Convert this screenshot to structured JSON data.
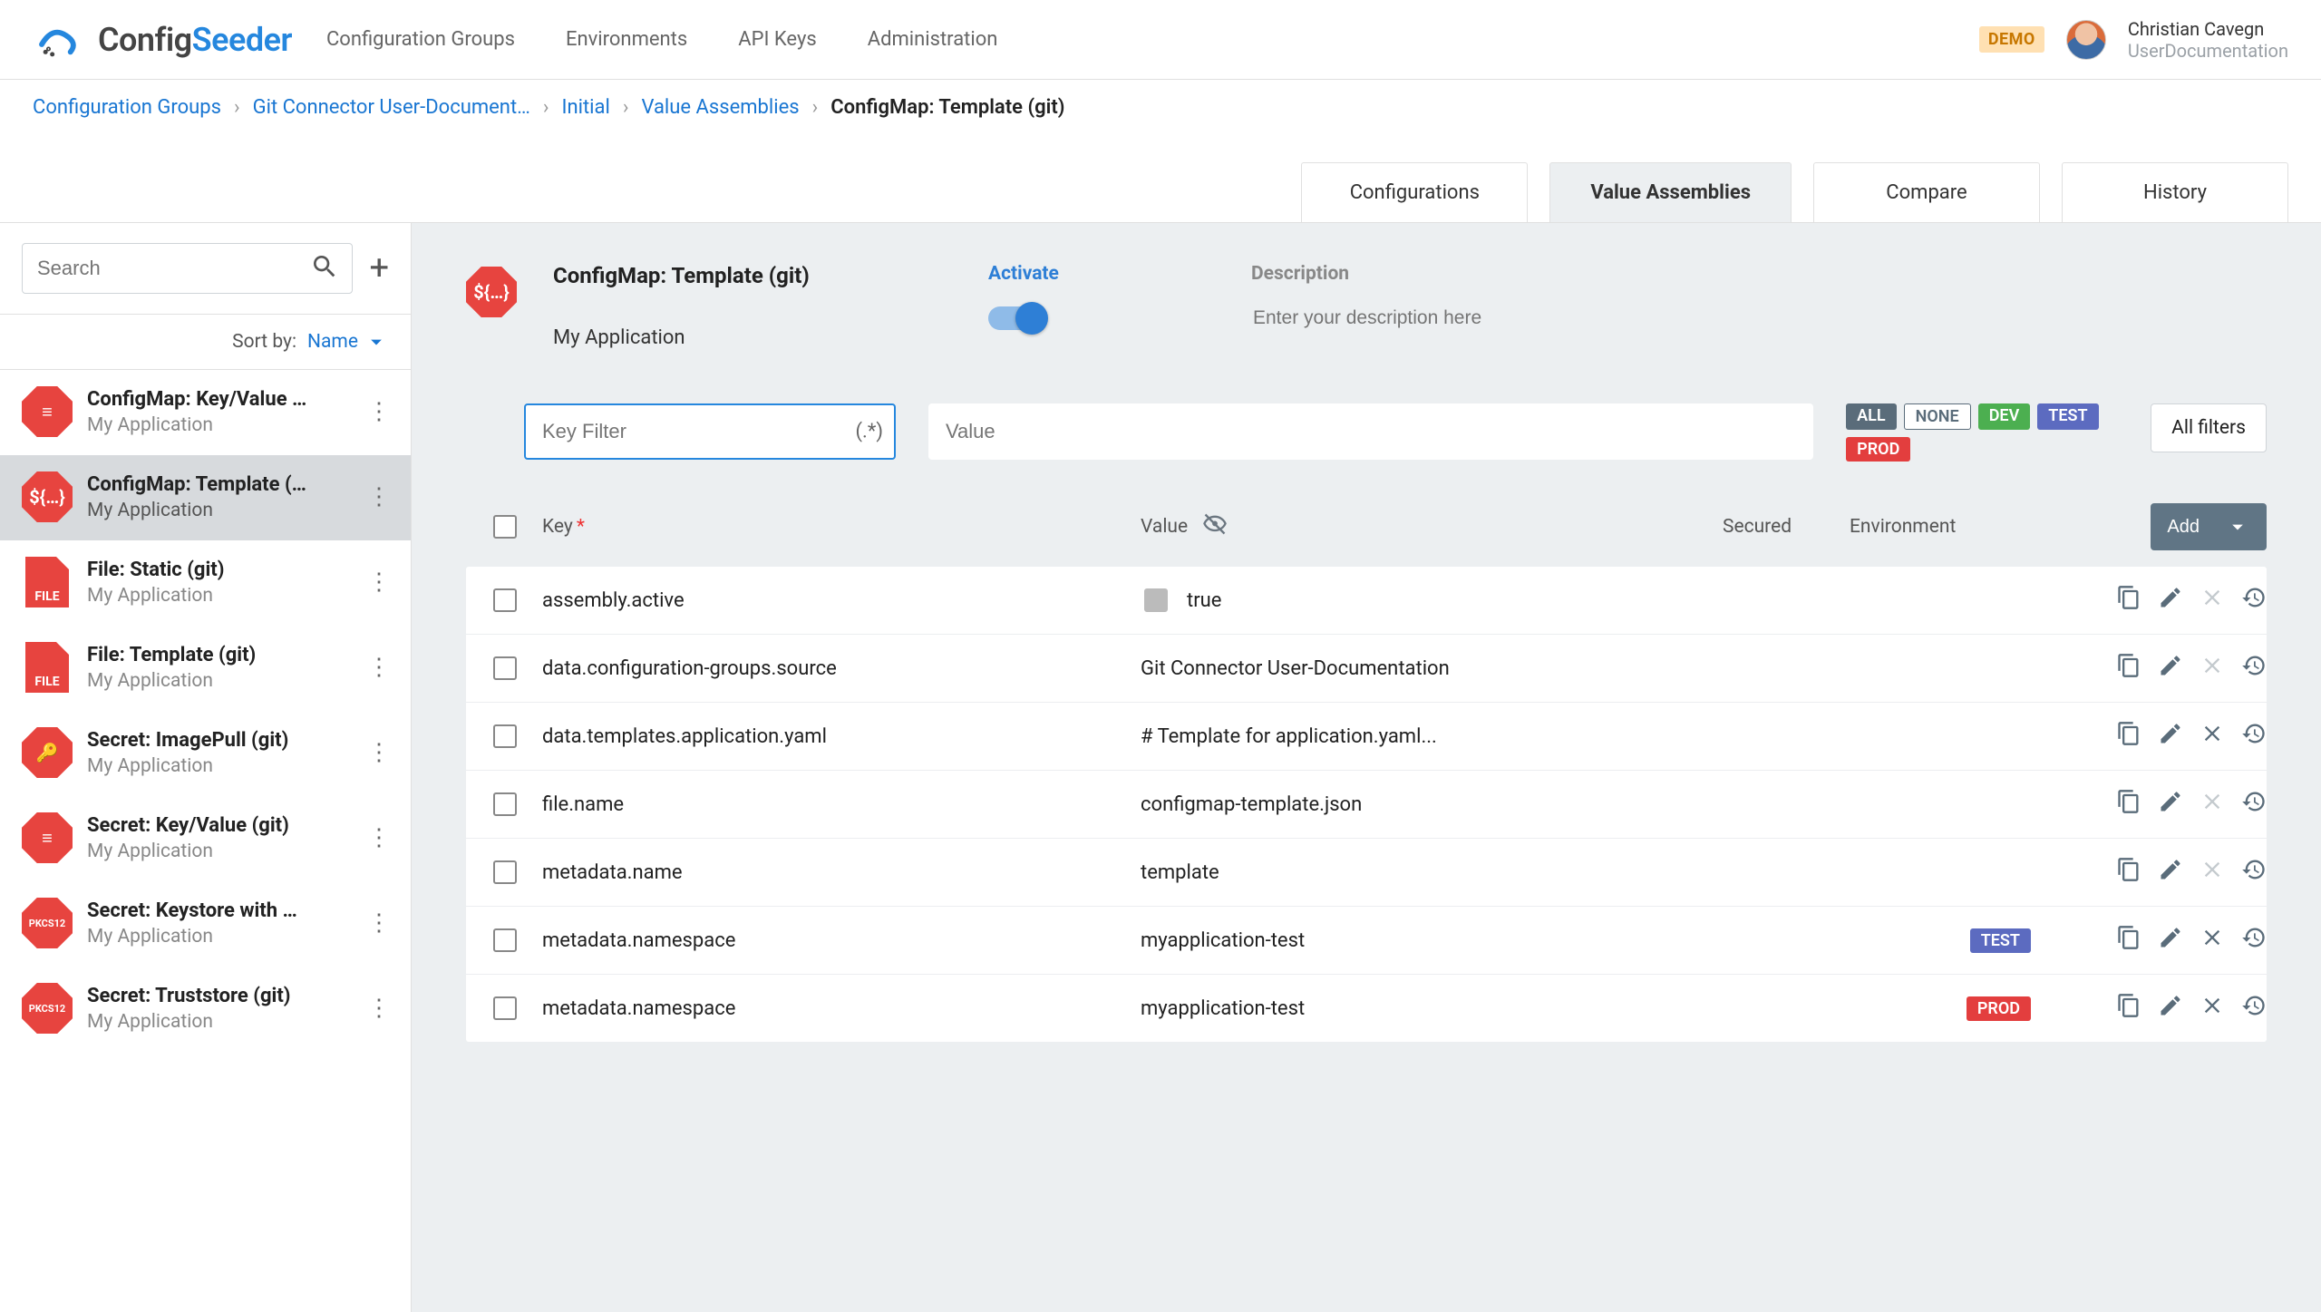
{
  "brand": {
    "a": "Config",
    "b": "Seeder"
  },
  "topnav": [
    "Configuration Groups",
    "Environments",
    "API Keys",
    "Administration"
  ],
  "demo_badge": "DEMO",
  "user": {
    "name": "Christian Cavegn",
    "org": "UserDocumentation"
  },
  "breadcrumb": [
    {
      "label": "Configuration Groups",
      "link": true
    },
    {
      "label": "Git Connector User-Document…",
      "link": true
    },
    {
      "label": "Initial",
      "link": true
    },
    {
      "label": "Value Assemblies",
      "link": true
    },
    {
      "label": "ConfigMap: Template (git)",
      "link": false
    }
  ],
  "tabs": [
    {
      "label": "Configurations",
      "active": false
    },
    {
      "label": "Value Assemblies",
      "active": true
    },
    {
      "label": "Compare",
      "active": false
    },
    {
      "label": "History",
      "active": false
    }
  ],
  "sidebar": {
    "search_placeholder": "Search",
    "sort_label": "Sort by:",
    "sort_value": "Name",
    "items": [
      {
        "title": "ConfigMap: Key/Value …",
        "sub": "My Application",
        "icon": "list",
        "selected": false
      },
      {
        "title": "ConfigMap: Template (…",
        "sub": "My Application",
        "icon": "tmpl",
        "selected": true
      },
      {
        "title": "File: Static (git)",
        "sub": "My Application",
        "icon": "file",
        "selected": false
      },
      {
        "title": "File: Template (git)",
        "sub": "My Application",
        "icon": "file",
        "selected": false
      },
      {
        "title": "Secret: ImagePull (git)",
        "sub": "My Application",
        "icon": "secret",
        "selected": false
      },
      {
        "title": "Secret: Key/Value (git)",
        "sub": "My Application",
        "icon": "list",
        "selected": false
      },
      {
        "title": "Secret: Keystore with …",
        "sub": "My Application",
        "icon": "pkcs",
        "selected": false
      },
      {
        "title": "Secret: Truststore (git)",
        "sub": "My Application",
        "icon": "pkcs",
        "selected": false
      }
    ]
  },
  "header": {
    "title": "ConfigMap: Template (git)",
    "subtitle": "My Application",
    "activate_label": "Activate",
    "description_label": "Description",
    "description_placeholder": "Enter your description here"
  },
  "filters": {
    "key_placeholder": "Key Filter",
    "regex_hint": "(.*)",
    "value_placeholder": "Value",
    "chips": [
      {
        "label": "ALL",
        "cls": "all"
      },
      {
        "label": "NONE",
        "cls": "none"
      },
      {
        "label": "DEV",
        "cls": "dev"
      },
      {
        "label": "TEST",
        "cls": "test"
      },
      {
        "label": "PROD",
        "cls": "prod"
      }
    ],
    "all_filters_label": "All filters"
  },
  "table": {
    "cols": {
      "key": "Key",
      "value": "Value",
      "secured": "Secured",
      "env": "Environment",
      "add": "Add"
    },
    "rows": [
      {
        "key": "assembly.active",
        "value": "true",
        "checkbox": true,
        "env": null,
        "del_enabled": false
      },
      {
        "key": "data.configuration-groups.source",
        "value": "Git Connector User-Documentation",
        "env": null,
        "del_enabled": false
      },
      {
        "key": "data.templates.application.yaml",
        "value": "# Template for application.yaml...",
        "env": null,
        "del_enabled": true
      },
      {
        "key": "file.name",
        "value": "configmap-template.json",
        "env": null,
        "del_enabled": false
      },
      {
        "key": "metadata.name",
        "value": "template",
        "env": null,
        "del_enabled": false
      },
      {
        "key": "metadata.namespace",
        "value": "myapplication-test",
        "env": "TEST",
        "del_enabled": true
      },
      {
        "key": "metadata.namespace",
        "value": "myapplication-test",
        "env": "PROD",
        "del_enabled": true
      }
    ]
  }
}
